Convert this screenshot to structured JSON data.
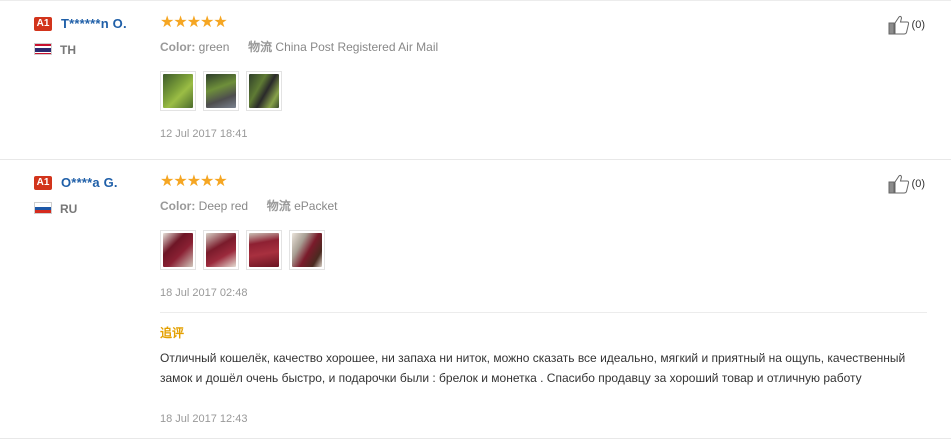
{
  "reviews": [
    {
      "level": "A1",
      "username": "T******n O.",
      "country": "TH",
      "rating": 5,
      "stars": "★★★★★",
      "color_label": "Color:",
      "color_value": "green",
      "shipping_label": "物流",
      "shipping_value": "China Post Registered Air Mail",
      "photos": [
        "photo-green-1",
        "photo-green-2",
        "photo-green-3"
      ],
      "date": "12 Jul 2017 18:41",
      "likes": "(0)"
    },
    {
      "level": "A1",
      "username": "O****a G.",
      "country": "RU",
      "rating": 5,
      "stars": "★★★★★",
      "color_label": "Color:",
      "color_value": "Deep red",
      "shipping_label": "物流",
      "shipping_value": "ePacket",
      "photos": [
        "photo-red-1",
        "photo-red-2",
        "photo-red-3",
        "photo-red-4"
      ],
      "date": "18 Jul 2017 02:48",
      "likes": "(0)",
      "additional": {
        "label": "追评",
        "text": "Отличный кошелёк, качество хорошее, ни запаха ни ниток, можно сказать все идеально, мягкий и приятный на ощупь, качественный замок и дошёл очень быстро, и подарочки были : брелок и монетка . Спасибо продавцу за хороший товар и отличную работу",
        "date": "18 Jul 2017 12:43"
      }
    }
  ],
  "colors": {
    "badge": "#d2341b",
    "username": "#1f5fa8",
    "star": "#f5a623",
    "additional_label": "#e4a000"
  }
}
